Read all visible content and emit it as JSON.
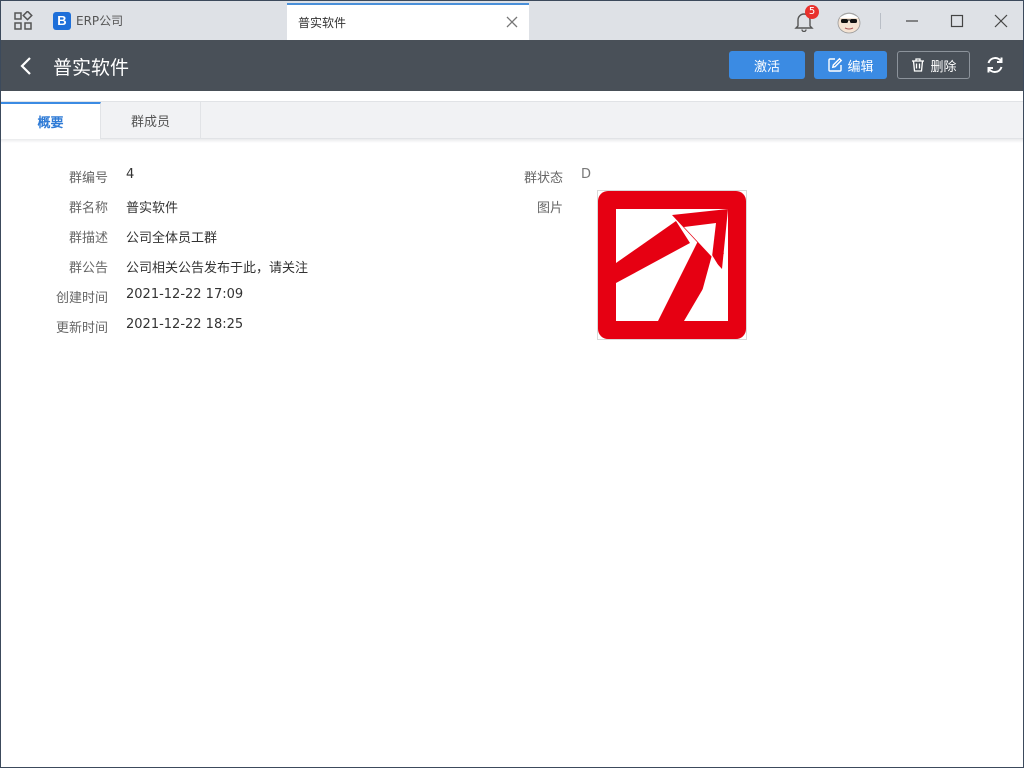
{
  "titlebar": {
    "app_label": "ERP公司",
    "app_logo_letter": "B",
    "active_tab": "普实软件",
    "notification_count": "5"
  },
  "header": {
    "title": "普实软件",
    "activate_label": "激活",
    "edit_label": "编辑",
    "delete_label": "删除"
  },
  "tabs": [
    {
      "label": "概要"
    },
    {
      "label": "群成员"
    }
  ],
  "fields_left": [
    {
      "label": "群编号",
      "value": "4"
    },
    {
      "label": "群名称",
      "value": "普实软件"
    },
    {
      "label": "群描述",
      "value": "公司全体员工群"
    },
    {
      "label": "群公告",
      "value": "公司相关公告发布于此，请关注"
    },
    {
      "label": "创建时间",
      "value": "2021-12-22 17:09"
    },
    {
      "label": "更新时间",
      "value": "2021-12-22 18:25"
    }
  ],
  "fields_right": [
    {
      "label": "群状态",
      "value": "D"
    },
    {
      "label": "图片",
      "value": ""
    }
  ],
  "colors": {
    "header_bg": "#495058",
    "primary": "#3b8be3",
    "logo_red": "#e60012"
  },
  "icons": {
    "apps": "apps-grid-icon",
    "close": "close-icon",
    "bell": "bell-icon",
    "back": "chevron-left-icon",
    "edit": "edit-icon",
    "delete": "trash-icon",
    "refresh": "refresh-icon"
  }
}
